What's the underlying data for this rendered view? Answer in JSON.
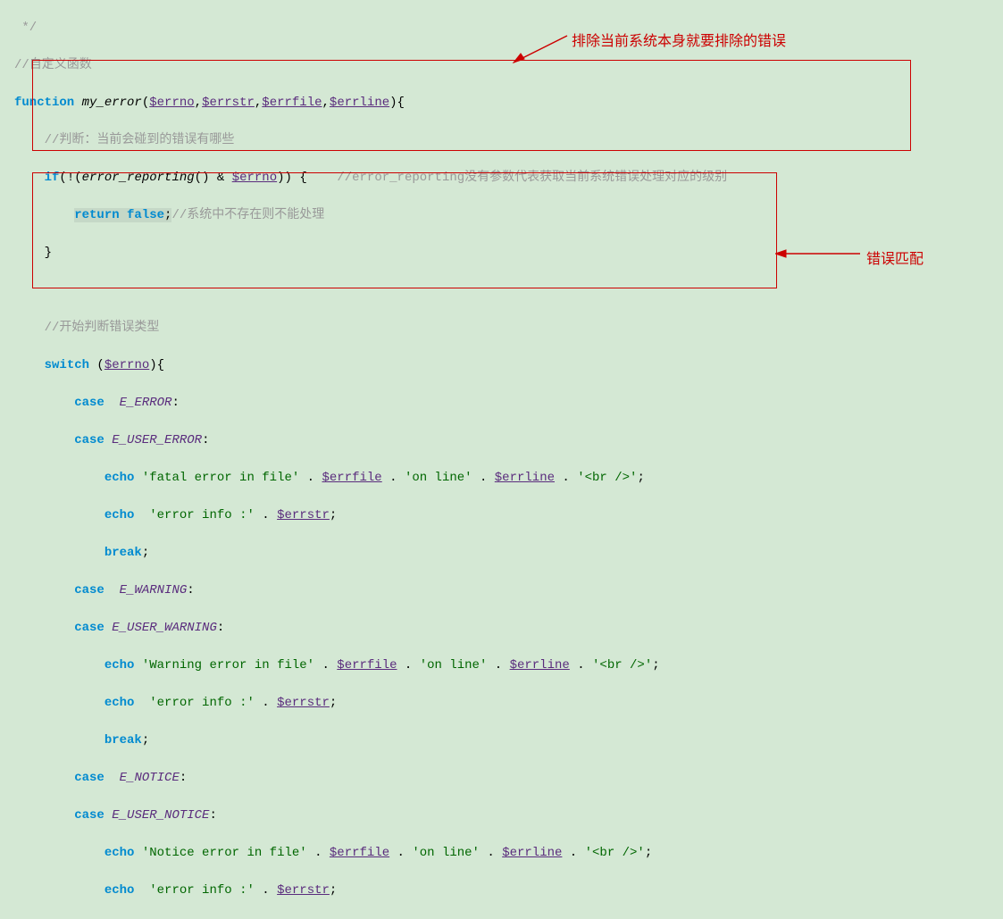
{
  "code": {
    "l0": " */",
    "c0": "//自定义函数",
    "fn_kw": "function",
    "fn_name": "my_error",
    "p1": "$errno",
    "p2": "$errstr",
    "p3": "$errfile",
    "p4": "$errline",
    "fn_tail": "){",
    "c1": "//判断：当前会碰到的错误有哪些",
    "if_kw": "if",
    "if_open": "(!(",
    "er_fn": "error_reporting",
    "if_mid": "() & ",
    "if_var": "$errno",
    "if_close": ")) {",
    "if_comment": "//error_reporting没有参数代表获取当前系统错误处理对应的级别",
    "ret_kw": "return false",
    "ret_semi": ";",
    "ret_comment": "//系统中不存在则不能处理",
    "close_brace": "}",
    "c2": "//开始判断错误类型",
    "switch_kw": "switch",
    "switch_var": "$errno",
    "switch_close": "){",
    "switch_open": " (",
    "case_kw": "case",
    "e_error": "E_ERROR",
    "e_user_error": "E_USER_ERROR",
    "echo_kw": "echo",
    "s_fatal": "'fatal error in file'",
    "s_online": "'on line'",
    "s_br": "'<br />'",
    "s_errinfo": "'error info :'",
    "colon": ":",
    "semi": ";",
    "dot": " . ",
    "break_kw": "break",
    "e_warning": "E_WARNING",
    "e_user_warning": "E_USER_WARNING",
    "s_warning": "'Warning error in file'",
    "e_notice": "E_NOTICE",
    "e_user_notice": "E_USER_NOTICE",
    "s_notice": "'Notice error in file'",
    "sp": " "
  },
  "ann": {
    "top": "排除当前系统本身就要排除的错误",
    "right": "错误匹配"
  }
}
